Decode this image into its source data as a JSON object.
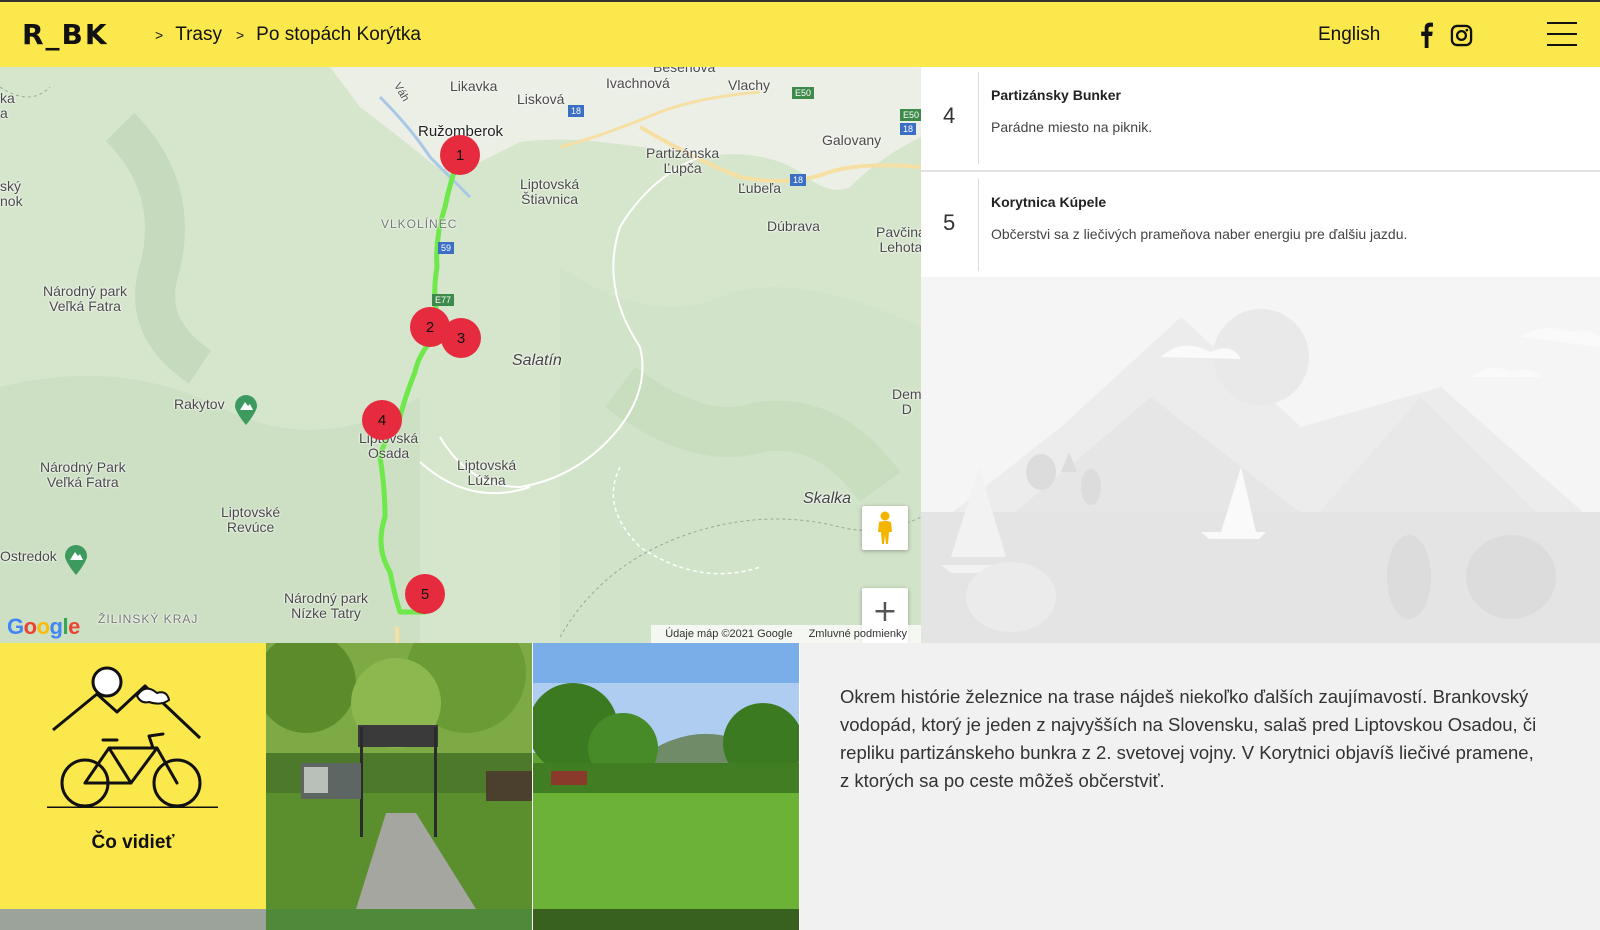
{
  "header": {
    "logo": "R_BK",
    "breadcrumb": [
      {
        "label": "Trasy"
      },
      {
        "label": "Po stopách Korýtka"
      }
    ],
    "separator": ">",
    "language": "English",
    "icons": {
      "facebook": "facebook-icon",
      "instagram": "instagram-icon",
      "menu": "hamburger-menu-icon"
    }
  },
  "map": {
    "places": {
      "besenova": "Bešeňová",
      "likavka": "Likavka",
      "liskova": "Lisková",
      "ivachnova": "Ivachnová",
      "vlachy": "Vlachy",
      "ruzomberok": "Ružomberok",
      "galovany": "Galovany",
      "partizanska_lupca": "Partizánska\nĽupča",
      "liptovska_stiavnica": "Liptovská\nŠtiavnica",
      "lubela": "Ľubeľa",
      "vlkolinec": "VLKOLÍNEC",
      "dubrava": "Dúbrava",
      "pavcina_lehota": "Pavčina\nLehota",
      "np_velka_fatra_1": "Národný park\nVeľká Fatra",
      "salatin": "Salatín",
      "rakytov": "Rakytov",
      "dem": "Dem\nD",
      "liptovska_osada": "Liptovská\nOsada",
      "liptovska_luzna": "Liptovská\nLúžna",
      "np_velka_fatra_2": "Národný Park\nVeľká Fatra",
      "liptovske_revuce": "Liptovské\nRevúce",
      "skalka": "Skalka",
      "ostredok": "Ostredok",
      "np_nizke_tatry": "Národný park\nNízke Tatry",
      "zilinsky_kraj": "ŽILINSKÝ KRAJ",
      "sky_nok": "ský\nnok",
      "ka_a": "ka\na",
      "vah": "Váh"
    },
    "roads": {
      "r18a": "18",
      "r18b": "18",
      "r18c": "18",
      "e50a": "E50",
      "e50b": "E50",
      "r59": "59",
      "e77": "E77"
    },
    "markers": [
      "1",
      "2",
      "3",
      "4",
      "5"
    ],
    "zoom_in": "+",
    "zoom_out": "−",
    "google": "Google",
    "attribution": "Údaje máp ©2021 Google",
    "terms": "Zmluvné podmienky",
    "colors": {
      "route": "#6ee84a",
      "marker": "#e52b3d"
    }
  },
  "stops": [
    {
      "number": "4",
      "name": "Partizánsky Bunker",
      "description": "Parádne miesto na piknik."
    },
    {
      "number": "5",
      "name": "Korytnica Kúpele",
      "description": "Občerstvi sa z liečivých prameňova naber energiu pre ďalšiu jazdu."
    }
  ],
  "see": {
    "label": "Čo vidieť",
    "icon": "mountain-bicycle-icon"
  },
  "description": "Okrem histórie železnice na trase nájdeš niekoľko ďalších zaujímavostí. Brankovský vodopád, ktorý je jeden z najvyšších na Slovensku, salaš pred Liptovskou Osadou, či repliku partizánskeho bunkra z 2. svetovej vojny. V Korytnici objavíš liečivé pramene, z ktorých sa po ceste môžeš občerstviť.",
  "colors": {
    "accent": "#fbe84c"
  }
}
